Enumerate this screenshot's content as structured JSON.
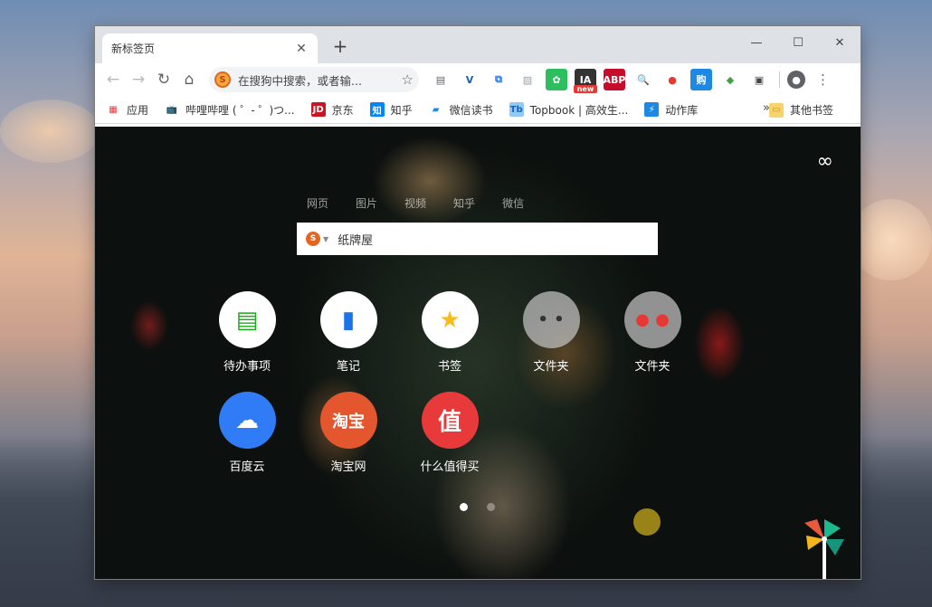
{
  "window": {
    "tab_title": "新标签页",
    "tab_close": "✕",
    "new_tab": "+",
    "controls": {
      "minimize": "—",
      "maximize": "☐",
      "close": "✕"
    }
  },
  "toolbar": {
    "back": "←",
    "forward": "→",
    "reload": "↻",
    "home": "⌂",
    "omnibox_logo": "S",
    "omnibox_placeholder": "在搜狗中搜索，或者输...",
    "star": "☆",
    "extensions": [
      {
        "name": "reader-icon",
        "glyph": "▤",
        "color": "#5f6368",
        "bg": "transparent"
      },
      {
        "name": "vue-devtools-icon",
        "glyph": "V",
        "color": "#1a5fb4",
        "bg": "transparent"
      },
      {
        "name": "screenshot-icon",
        "glyph": "⧉",
        "color": "#1a73e8",
        "bg": "transparent"
      },
      {
        "name": "image-icon",
        "glyph": "▨",
        "color": "#9aa0a6",
        "bg": "transparent"
      },
      {
        "name": "evernote-icon",
        "glyph": "✿",
        "color": "#fff",
        "bg": "#2dbe60"
      },
      {
        "name": "ia-new-icon",
        "glyph": "IA",
        "color": "#fff",
        "bg": "#333"
      },
      {
        "name": "adblock-plus-icon",
        "glyph": "ABP",
        "color": "#fff",
        "bg": "#c70d2c"
      },
      {
        "name": "magnifier-icon",
        "glyph": "🔍",
        "color": "#5f6368",
        "bg": "transparent"
      },
      {
        "name": "tomato-icon",
        "glyph": "●",
        "color": "#e53935",
        "bg": "transparent"
      },
      {
        "name": "shopping-icon",
        "glyph": "购",
        "color": "#fff",
        "bg": "#1e88e5"
      },
      {
        "name": "colorful-icon",
        "glyph": "◆",
        "color": "#43a047",
        "bg": "transparent"
      },
      {
        "name": "tampermonkey-icon",
        "glyph": "▣",
        "color": "#444",
        "bg": "transparent"
      }
    ],
    "ia_badge": "new",
    "profile": "●",
    "menu": "⋮"
  },
  "bookmarks": {
    "items": [
      {
        "label": "应用",
        "icon": "▦",
        "bg": "transparent",
        "color": "#e53935",
        "name": "bookmark-apps"
      },
      {
        "label": "哔哩哔哩 ( ゜- ゜)つ...",
        "icon": "📺",
        "bg": "transparent",
        "color": "#00a1d6",
        "name": "bookmark-bilibili"
      },
      {
        "label": "京东",
        "icon": "JD",
        "bg": "#c81623",
        "color": "#fff",
        "name": "bookmark-jd"
      },
      {
        "label": "知乎",
        "icon": "知",
        "bg": "#0084ff",
        "color": "#fff",
        "name": "bookmark-zhihu"
      },
      {
        "label": "微信读书",
        "icon": "▰",
        "bg": "transparent",
        "color": "#1e88e5",
        "name": "bookmark-weread"
      },
      {
        "label": "Topbook | 高效生...",
        "icon": "Tb",
        "bg": "#90caf9",
        "color": "#1565c0",
        "name": "bookmark-topbook"
      },
      {
        "label": "动作库",
        "icon": "⚡",
        "bg": "#1e88e5",
        "color": "#fff",
        "name": "bookmark-action-lib"
      }
    ],
    "overflow": "»",
    "other": {
      "label": "其他书签",
      "icon": "▭"
    }
  },
  "newtab": {
    "infinity": "∞",
    "search_tabs": [
      "网页",
      "图片",
      "视频",
      "知乎",
      "微信"
    ],
    "search_logo": "S",
    "search_caret": "▼",
    "search_value": "纸牌屋",
    "apps": [
      {
        "label": "待办事项",
        "bg": "#ffffff",
        "icon_color": "#1aad19",
        "glyph": "▤",
        "name": "app-todo"
      },
      {
        "label": "笔记",
        "bg": "#ffffff",
        "icon_color": "#1a73e8",
        "glyph": "▮",
        "name": "app-notes"
      },
      {
        "label": "书签",
        "bg": "#ffffff",
        "icon_color": "#f9ba1c",
        "glyph": "★",
        "name": "app-bookmarks"
      },
      {
        "label": "文件夹",
        "bg": "rgba(190,190,190,0.75)",
        "icon_color": "#333",
        "glyph": "• •",
        "name": "app-folder-1"
      },
      {
        "label": "文件夹",
        "bg": "rgba(190,190,190,0.75)",
        "icon_color": "#e53935",
        "glyph": "● ●",
        "name": "app-folder-2"
      },
      {
        "label": "百度云",
        "bg": "#2f7cf6",
        "icon_color": "#ffffff",
        "glyph": "☁",
        "name": "app-baidu-cloud"
      },
      {
        "label": "淘宝网",
        "bg": "#e4572e",
        "icon_color": "#ffffff",
        "glyph": "淘宝",
        "name": "app-taobao"
      },
      {
        "label": "什么值得买",
        "bg": "#e83a3a",
        "icon_color": "#ffffff",
        "glyph": "值",
        "name": "app-smzdm"
      }
    ],
    "pages": 2,
    "active_page": 1
  }
}
